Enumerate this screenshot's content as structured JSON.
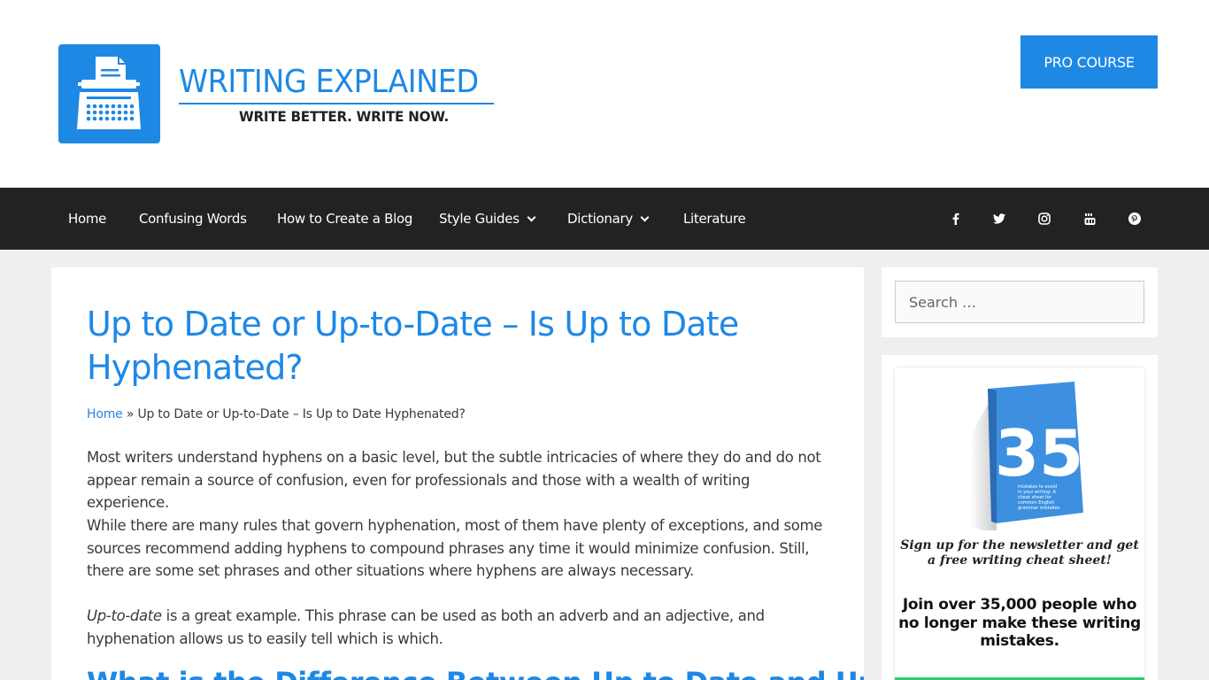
{
  "header": {
    "brand_title": "WRITING EXPLAINED",
    "brand_tagline": "WRITE BETTER. WRITE NOW.",
    "cta_label": "PRO COURSE",
    "accent_color": "#1e88e5"
  },
  "nav": {
    "items": [
      {
        "label": "Home"
      },
      {
        "label": "Confusing Words"
      },
      {
        "label": "How to Create a Blog"
      },
      {
        "label": "Style Guides"
      },
      {
        "label": "Dictionary"
      },
      {
        "label": "Literature"
      }
    ],
    "social": [
      {
        "icon": "facebook-icon",
        "glyph": "f"
      },
      {
        "icon": "twitter-icon",
        "glyph": "t"
      },
      {
        "icon": "instagram-icon",
        "glyph": "ig"
      },
      {
        "icon": "youtube-icon",
        "glyph": "yt"
      },
      {
        "icon": "pinterest-icon",
        "glyph": "p"
      }
    ],
    "background_color": "#222222"
  },
  "article": {
    "title": "Up to Date or Up-to-Date – Is Up to Date Hyphenated?",
    "breadcrumb_home": "Home",
    "breadcrumb_sep": "»",
    "breadcrumb_current": "Up to Date or Up-to-Date – Is Up to Date Hyphenated?",
    "p1": "Most writers understand hyphens on a basic level, but the subtle intricacies of where they do and do not appear remain a source of confusion, even for professionals and those with a wealth of writing experience.",
    "p2": "While there are many rules that govern hyphenation, most of them have plenty of exceptions, and some sources recommend adding hyphens to compound phrases any time it would minimize confusion. Still, there are some set phrases and other situations where hyphens are always necessary.",
    "p3_em": "Up-to-date",
    "p3_rest": " is a great example. This phrase can be used as both an adverb and an adjective, and hyphenation allows us to easily tell which is which.",
    "subheading": "What is the Difference Between Up to Date and Up-to-Date?"
  },
  "sidebar": {
    "search_placeholder": "Search …",
    "book_number": "35",
    "book_blurb": "mistakes to avoid in your writing: A cheat sheet for common English grammar mistakes.",
    "promo_italic": "Sign up for the newsletter and get a free writing cheat sheet!",
    "promo_bold": "Join over 35,000 people who no longer make these writing mistakes."
  }
}
